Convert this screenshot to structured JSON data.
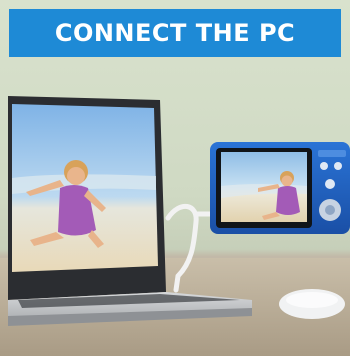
{
  "banner": {
    "title": "CONNECT THE PC"
  },
  "colors": {
    "banner": "#1e8ad6",
    "camera_body": "#1f5fc4",
    "wall": "#d4ddc8",
    "desk": "#b8ac98"
  },
  "scene": {
    "laptop": "laptop-with-beach-photo",
    "camera": "blue-digital-camera",
    "cable": "usb-cable",
    "mouse": "wireless-mouse"
  }
}
